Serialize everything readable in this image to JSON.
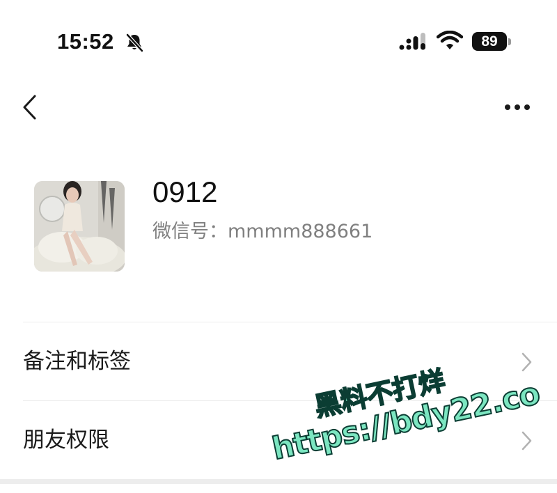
{
  "status_bar": {
    "time": "15:52",
    "battery": "89",
    "icons": [
      "bell-off-icon",
      "signal-icon",
      "wifi-icon",
      "battery-icon"
    ]
  },
  "nav": {
    "back_icon": "chevron-left-icon",
    "more_icon": "more-horizontal-icon"
  },
  "profile": {
    "nickname": "0912",
    "wechat_id": "微信号：mmmm888661"
  },
  "list": [
    {
      "label": "备注和标签",
      "icon": "chevron-right-icon"
    },
    {
      "label": "朋友权限",
      "icon": "chevron-right-icon"
    }
  ],
  "watermark": {
    "line1": "黑料不打烊",
    "line2": "https://bdy22.co"
  },
  "colors": {
    "text_primary": "#111111",
    "text_secondary": "#808080",
    "divider": "#ececec",
    "chevron": "#b2b2b2",
    "watermark_fill": "#7ce6c1",
    "watermark_stroke": "#0b3d33"
  }
}
